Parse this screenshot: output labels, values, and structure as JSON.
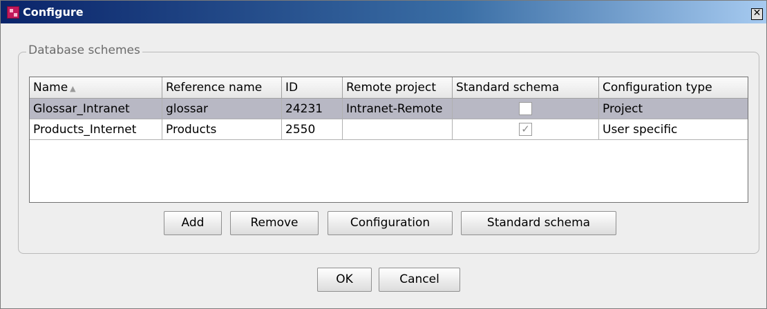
{
  "window": {
    "title": "Configure",
    "close_glyph": "✕"
  },
  "group": {
    "label": "Database schemes"
  },
  "table": {
    "columns": [
      "Name",
      "Reference name",
      "ID",
      "Remote project",
      "Standard schema",
      "Configuration type"
    ],
    "sort_indicator": "▲",
    "rows": [
      {
        "name": "Glossar_Intranet",
        "reference": "glossar",
        "id": "24231",
        "remote": "Intranet-Remote",
        "standard": false,
        "standard_glyph": "",
        "type": "Project",
        "selected": true
      },
      {
        "name": "Products_Internet",
        "reference": "Products",
        "id": "2550",
        "remote": "",
        "standard": true,
        "standard_glyph": "✓",
        "type": "User specific",
        "selected": false
      }
    ]
  },
  "buttons": {
    "add": "Add",
    "remove": "Remove",
    "configuration": "Configuration",
    "standard_schema": "Standard schema",
    "ok": "OK",
    "cancel": "Cancel"
  }
}
